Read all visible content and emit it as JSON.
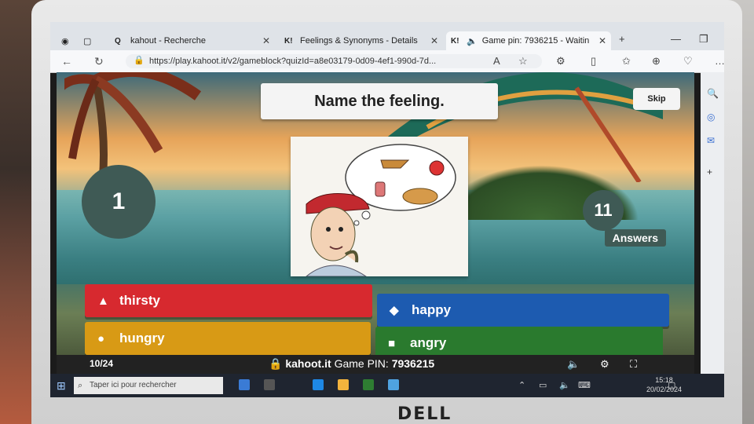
{
  "browser": {
    "tabs": [
      {
        "icon": "Q",
        "label": "kahout - Recherche"
      },
      {
        "icon": "K!",
        "label": "Feelings & Synonyms - Details -"
      },
      {
        "icon": "K!",
        "label": "Game pin: 7936215 - Waitin"
      }
    ],
    "url": "https://play.kahoot.it/v2/gameblock?quizId=a8e03179-0d09-4ef1-990d-7d..."
  },
  "game": {
    "question": "Name the feeling.",
    "skip_label": "Skip",
    "timer": "1",
    "answers_count": "11",
    "answers_label": "Answers",
    "answers": [
      {
        "shape": "▲",
        "label": "thirsty",
        "color": "#d7292f"
      },
      {
        "shape": "◆",
        "label": "happy",
        "color": "#1d5bb0"
      },
      {
        "shape": "●",
        "label": "hungry",
        "color": "#d89a15"
      },
      {
        "shape": "■",
        "label": "angry",
        "color": "#2a7a2e"
      }
    ],
    "progress": "10/24",
    "site": "kahoot.it",
    "pin_label": "Game PIN:",
    "pin_value": "7936215"
  },
  "taskbar": {
    "search_placeholder": "Taper ici pour rechercher",
    "time": "15:18",
    "date": "20/02/2024"
  },
  "monitor": {
    "brand": "DELL"
  }
}
